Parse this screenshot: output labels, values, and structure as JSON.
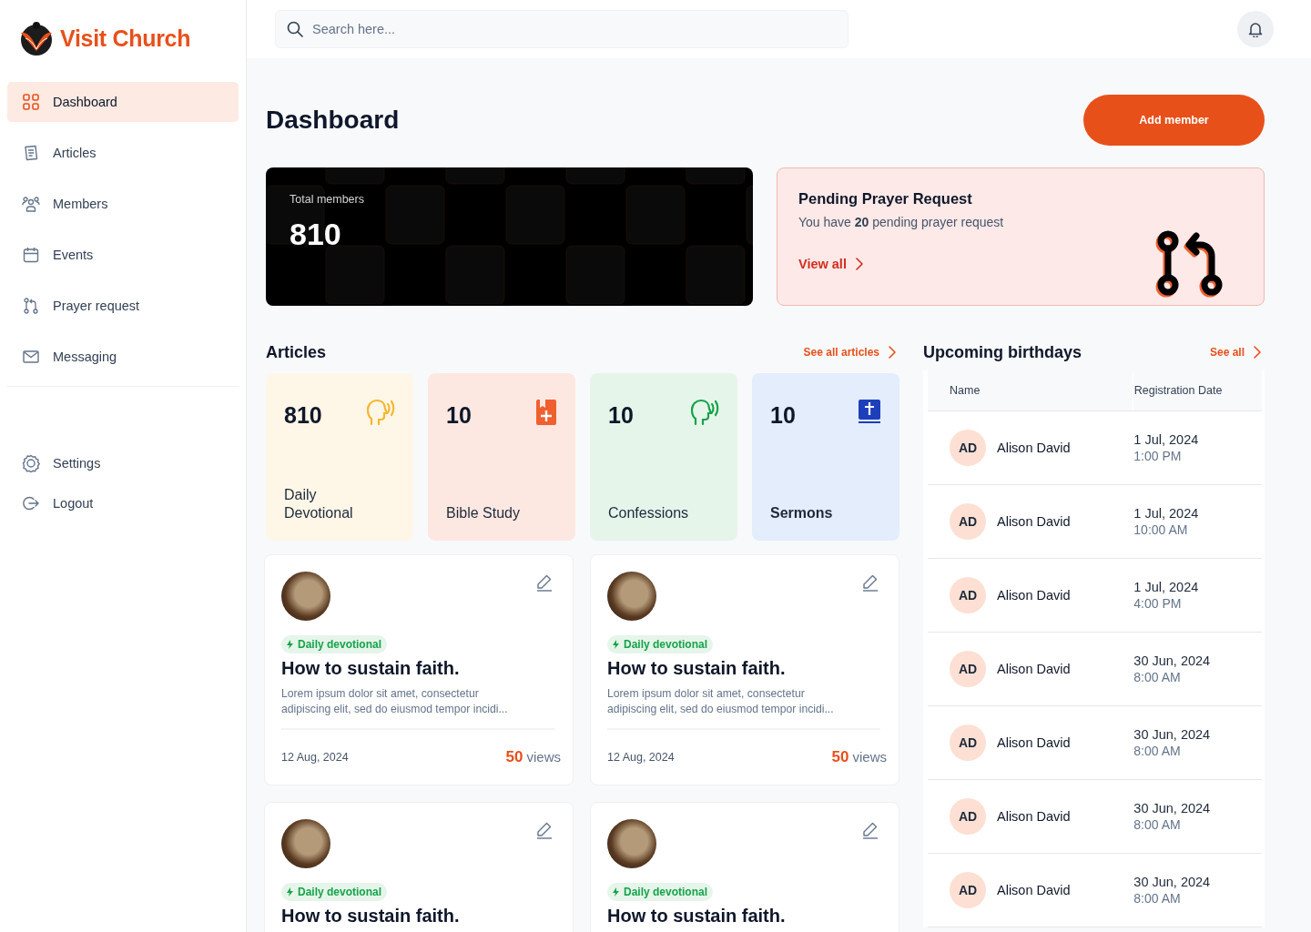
{
  "brand": {
    "name": "Visit Church"
  },
  "sidebar": {
    "items": [
      {
        "label": "Dashboard",
        "kind": "dashboard",
        "selected": true
      },
      {
        "label": "Articles",
        "kind": "articles",
        "selected": false
      },
      {
        "label": "Members",
        "kind": "members",
        "selected": false
      },
      {
        "label": "Events",
        "kind": "events",
        "selected": false
      },
      {
        "label": "Prayer request",
        "kind": "prayer",
        "selected": false
      },
      {
        "label": "Messaging",
        "kind": "messaging",
        "selected": false
      }
    ],
    "bottom_items": [
      {
        "label": "Settings",
        "kind": "settings"
      },
      {
        "label": "Logout",
        "kind": "logout"
      }
    ]
  },
  "search": {
    "placeholder": "Search here..."
  },
  "page_title": "Dashboard",
  "add_button": "Add member",
  "total_members": {
    "label": "Total members",
    "value": "810"
  },
  "prayer_card": {
    "title": "Pending Prayer Request",
    "text": "You have **20** pending prayer request",
    "link": "View all"
  },
  "articles": {
    "title": "Articles",
    "see_all": "See all articles",
    "stats": [
      {
        "value": "810",
        "label": "Daily Devotional",
        "kind": "devotional"
      },
      {
        "value": "10",
        "label": "Bible Study",
        "kind": "bible"
      },
      {
        "value": "10",
        "label": "Confessions",
        "kind": "confession"
      },
      {
        "value": "10",
        "label": "Sermons",
        "kind": "sermon"
      }
    ],
    "posts": [
      {
        "tag": "Daily devotional",
        "title": "How to sustain faith.",
        "excerpt": "Lorem ipsum dolor sit amet, consectetur adipiscing elit, sed do eiusmod tempor incidi...",
        "date": "12 Aug, 2024",
        "views": "50",
        "views_label": "views"
      },
      {
        "tag": "Daily devotional",
        "title": "How to sustain faith.",
        "excerpt": "Lorem ipsum dolor sit amet, consectetur adipiscing elit, sed do eiusmod tempor incidi...",
        "date": "12 Aug, 2024",
        "views": "50",
        "views_label": "views"
      },
      {
        "tag": "Daily devotional",
        "title": "How to sustain faith."
      },
      {
        "tag": "Daily devotional",
        "title": "How to sustain faith."
      }
    ]
  },
  "birthdays": {
    "title": "Upcoming birthdays",
    "see_all": "See all",
    "columns": [
      "Name",
      "Registration Date"
    ],
    "rows": [
      {
        "initials": "AD",
        "name": "Alison David",
        "date": "1 Jul, 2024",
        "time": "1:00 PM"
      },
      {
        "initials": "AD",
        "name": "Alison David",
        "date": "1 Jul, 2024",
        "time": "10:00 AM"
      },
      {
        "initials": "AD",
        "name": "Alison David",
        "date": "1 Jul, 2024",
        "time": "4:00 PM"
      },
      {
        "initials": "AD",
        "name": "Alison David",
        "date": "30 Jun, 2024",
        "time": "8:00 AM"
      },
      {
        "initials": "AD",
        "name": "Alison David",
        "date": "30 Jun, 2024",
        "time": "8:00 AM"
      },
      {
        "initials": "AD",
        "name": "Alison David",
        "date": "30 Jun, 2024",
        "time": "8:00 AM"
      },
      {
        "initials": "AD",
        "name": "Alison David",
        "date": "30 Jun, 2024",
        "time": "8:00 AM"
      }
    ]
  }
}
